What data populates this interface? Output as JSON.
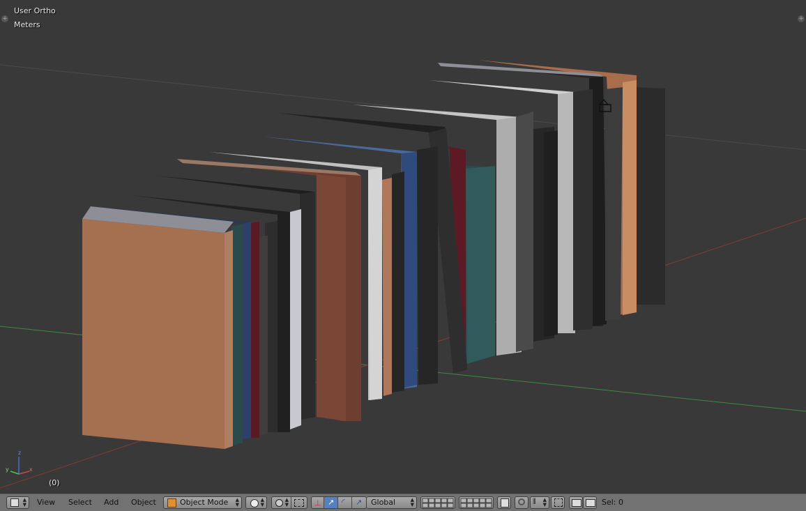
{
  "viewport": {
    "view_name": "User Ortho",
    "units": "Meters",
    "frame": "(0)",
    "axis_labels": {
      "z": "z",
      "x": "x",
      "y": "y"
    }
  },
  "header": {
    "menus": [
      "View",
      "Select",
      "Add",
      "Object"
    ],
    "mode": "Object Mode",
    "orientation": "Global",
    "selection": "Sel: 0"
  },
  "colors": {
    "viewport_bg": "#393939",
    "header_bg": "#727272",
    "x_axis": "#8a3a3a",
    "y_axis": "#3a8a3a",
    "active_button": "#5680c2"
  }
}
